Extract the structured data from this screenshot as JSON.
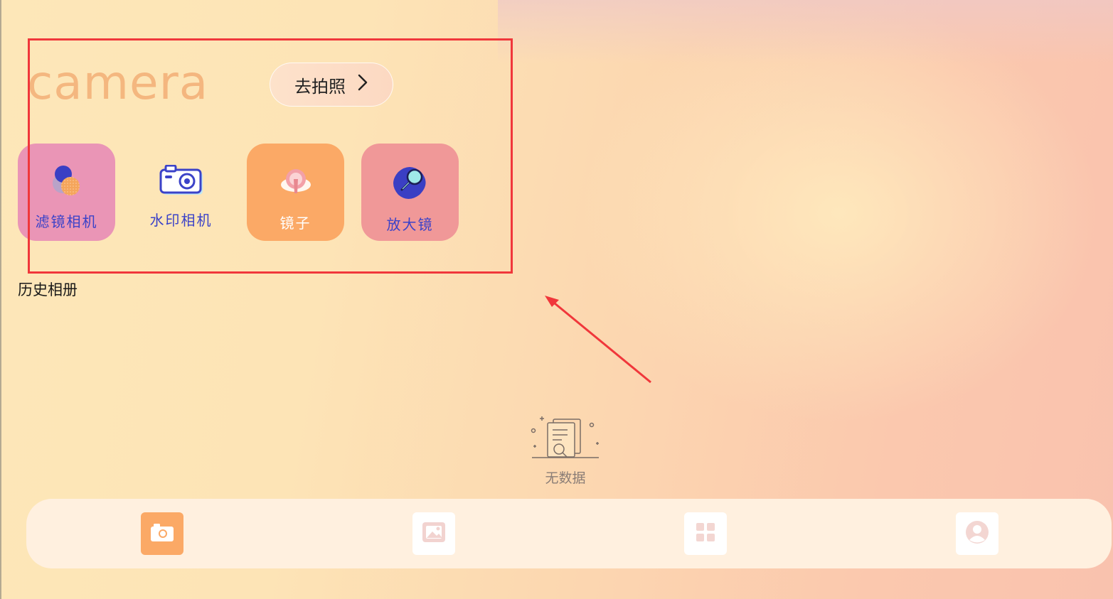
{
  "app": {
    "brand": "camera"
  },
  "header": {
    "shoot_label": "去拍照",
    "shoot_chevron": "›"
  },
  "tools": [
    {
      "label": "滤镜相机",
      "icon": "filter-circles-icon"
    },
    {
      "label": "水印相机",
      "icon": "camera-outline-icon"
    },
    {
      "label": "镜子",
      "icon": "hand-mirror-icon"
    },
    {
      "label": "放大镜",
      "icon": "magnifier-icon"
    }
  ],
  "history": {
    "title": "历史相册",
    "empty_text": "无数据",
    "empty_icon": "no-data-documents-icon"
  },
  "tabbar": [
    {
      "icon": "camera-icon",
      "active": true
    },
    {
      "icon": "image-icon",
      "active": false
    },
    {
      "icon": "grid-icon",
      "active": false
    },
    {
      "icon": "user-icon",
      "active": false
    }
  ],
  "colors": {
    "accent": "#fba966",
    "tool_label_blue": "#3b42c8",
    "annotation_red": "#f0373b",
    "filter_tile": "#ea95b6",
    "mirror_tile": "#fba966",
    "magnifier_tile": "#f09898"
  }
}
